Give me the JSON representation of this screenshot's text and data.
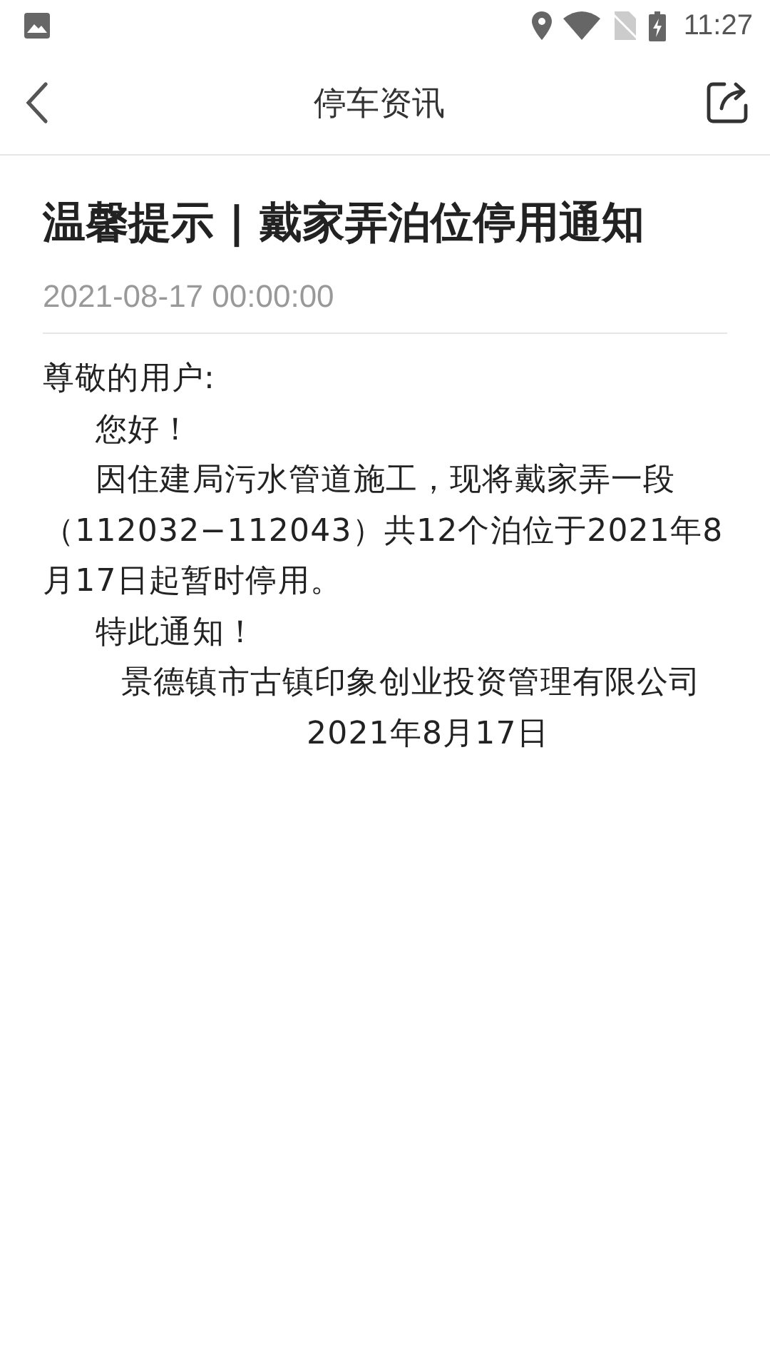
{
  "status_bar": {
    "time": "11:27"
  },
  "header": {
    "title": "停车资讯"
  },
  "article": {
    "title": "温馨提示 | 戴家弄泊位停用通知",
    "date": "2021-08-17 00:00:00",
    "paragraphs": [
      {
        "kind": "plain",
        "text": "尊敬的用户:"
      },
      {
        "kind": "indent",
        "text": "您好！"
      },
      {
        "kind": "indent",
        "text": "因住建局污水管道施工，现将戴家弄一段（112032−112043）共12个泊位于2021年8月17日起暂时停用。"
      },
      {
        "kind": "indent",
        "text": "特此通知！"
      },
      {
        "kind": "signature",
        "text": "景德镇市古镇印象创业投资管理有限公司"
      },
      {
        "kind": "date",
        "text": "2021年8月17日"
      }
    ]
  }
}
